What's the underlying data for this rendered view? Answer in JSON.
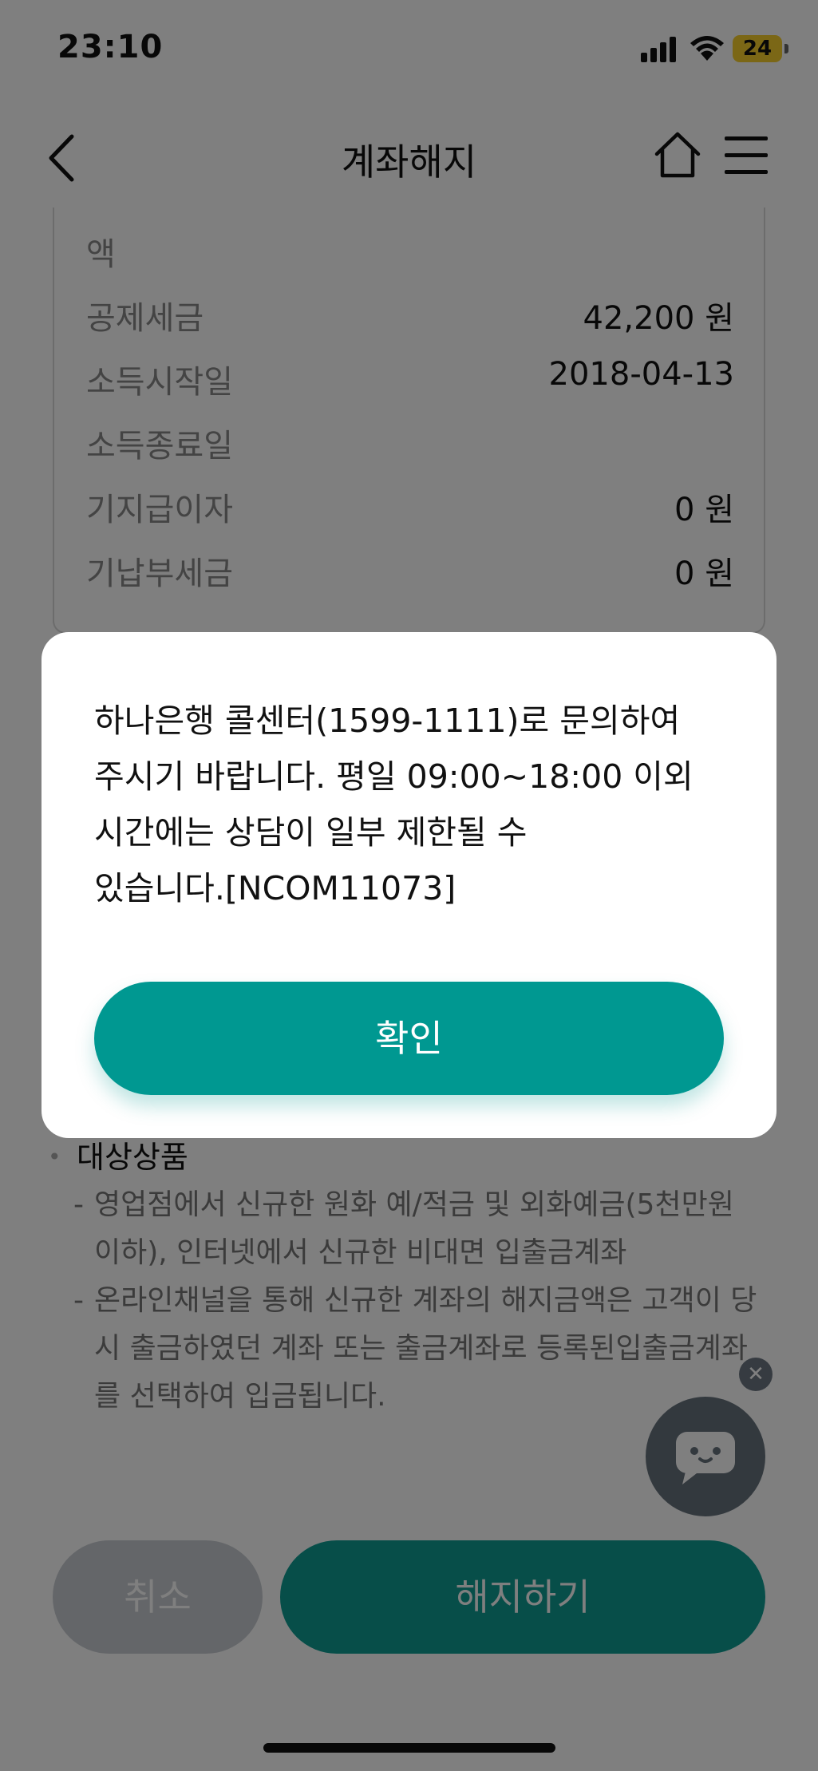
{
  "status_bar": {
    "time": "23:10",
    "battery": "24"
  },
  "nav": {
    "title": "계좌해지"
  },
  "info": {
    "partial_label": "액",
    "rows": [
      {
        "label": "공제세금",
        "value": "42,200 원"
      },
      {
        "label": "소득시작일",
        "value": "2018-04-13"
      },
      {
        "label": "소득종료일",
        "value": ""
      },
      {
        "label": "기지급이자",
        "value": "0 원"
      },
      {
        "label": "기납부세금",
        "value": "0 원"
      }
    ]
  },
  "notice": {
    "title": "대상상품",
    "items": [
      "영업점에서 신규한 원화 예/적금 및 외화예금(5천만원 이하), 인터넷에서 신규한 비대면 입출금계좌",
      "온라인채널을 통해 신규한 계좌의 해지금액은 고객이 당시 출금하였던 계좌 또는 출금계좌로 등록된입출금계좌를 선택하여 입금됩니다."
    ]
  },
  "chatbot": {
    "close": "✕"
  },
  "buttons": {
    "cancel": "취소",
    "terminate": "해지하기"
  },
  "dialog": {
    "message": "하나은행 콜센터(1599-1111)로 문의하여\n주시기 바랍니다. 평일 09:00~18:00 이외\n시간에는 상담이 일부 제한될 수\n있습니다.[NCOM11073]",
    "confirm": "확인"
  },
  "colors": {
    "accent": "#009891",
    "cancel": "#c9cdd2",
    "battery": "#f7cf2d"
  },
  "icons": [
    "back-icon",
    "home-icon",
    "menu-icon",
    "chat-icon",
    "close-icon"
  ]
}
